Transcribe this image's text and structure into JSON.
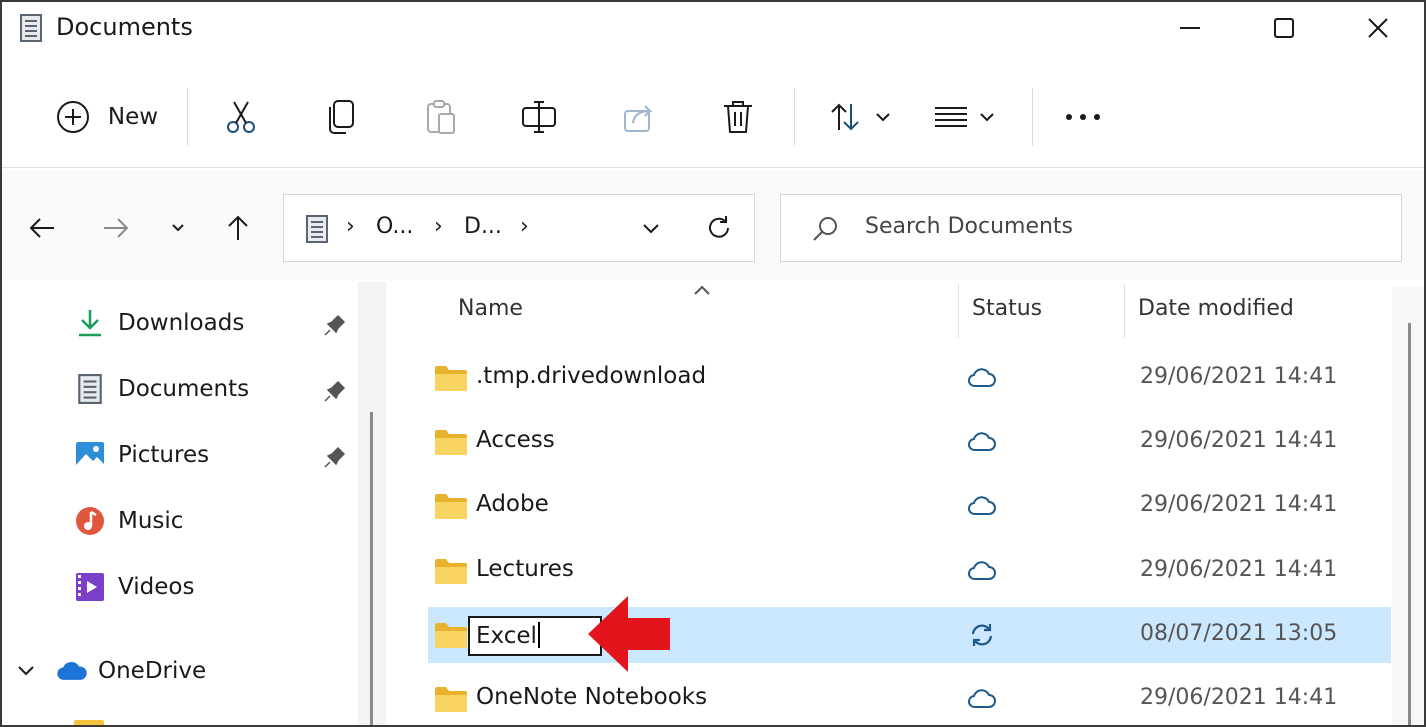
{
  "window": {
    "title": "Documents",
    "icons": {
      "app": "document-icon",
      "minimize": "minimize-icon",
      "maximize": "maximize-icon",
      "close": "close-icon"
    }
  },
  "toolbar": {
    "new_label": "New",
    "buttons": [
      "cut-icon",
      "copy-icon",
      "paste-icon",
      "rename-icon",
      "share-icon",
      "delete-icon",
      "sort-icon",
      "view-icon",
      "more-icon"
    ]
  },
  "nav": {
    "breadcrumbs": [
      "O...",
      "D..."
    ],
    "search_placeholder": "Search Documents"
  },
  "sidebar": {
    "items": [
      {
        "label": "Downloads",
        "icon": "download-icon",
        "pinned": true
      },
      {
        "label": "Documents",
        "icon": "document-icon",
        "pinned": true
      },
      {
        "label": "Pictures",
        "icon": "pictures-icon",
        "pinned": true
      },
      {
        "label": "Music",
        "icon": "music-icon",
        "pinned": false
      },
      {
        "label": "Videos",
        "icon": "videos-icon",
        "pinned": false
      },
      {
        "label": "OneDrive",
        "icon": "onedrive-icon",
        "pinned": false
      }
    ]
  },
  "files": {
    "columns": {
      "name": "Name",
      "status": "Status",
      "date": "Date modified"
    },
    "rows": [
      {
        "name": ".tmp.drivedownload",
        "status": "cloud",
        "date": "29/06/2021 14:41"
      },
      {
        "name": "Access",
        "status": "cloud",
        "date": "29/06/2021 14:41"
      },
      {
        "name": "Adobe",
        "status": "cloud",
        "date": "29/06/2021 14:41"
      },
      {
        "name": "Lectures",
        "status": "cloud",
        "date": "29/06/2021 14:41"
      },
      {
        "name": "Excel",
        "status": "syncing",
        "date": "08/07/2021 13:05",
        "selected": true,
        "renaming": true
      },
      {
        "name": "OneNote Notebooks",
        "status": "cloud",
        "date": "29/06/2021 14:41"
      }
    ]
  },
  "colors": {
    "accent": "#0067c0",
    "selection": "#cce8ff",
    "folder": "#f5c542",
    "annotation_arrow": "#e3141b"
  }
}
